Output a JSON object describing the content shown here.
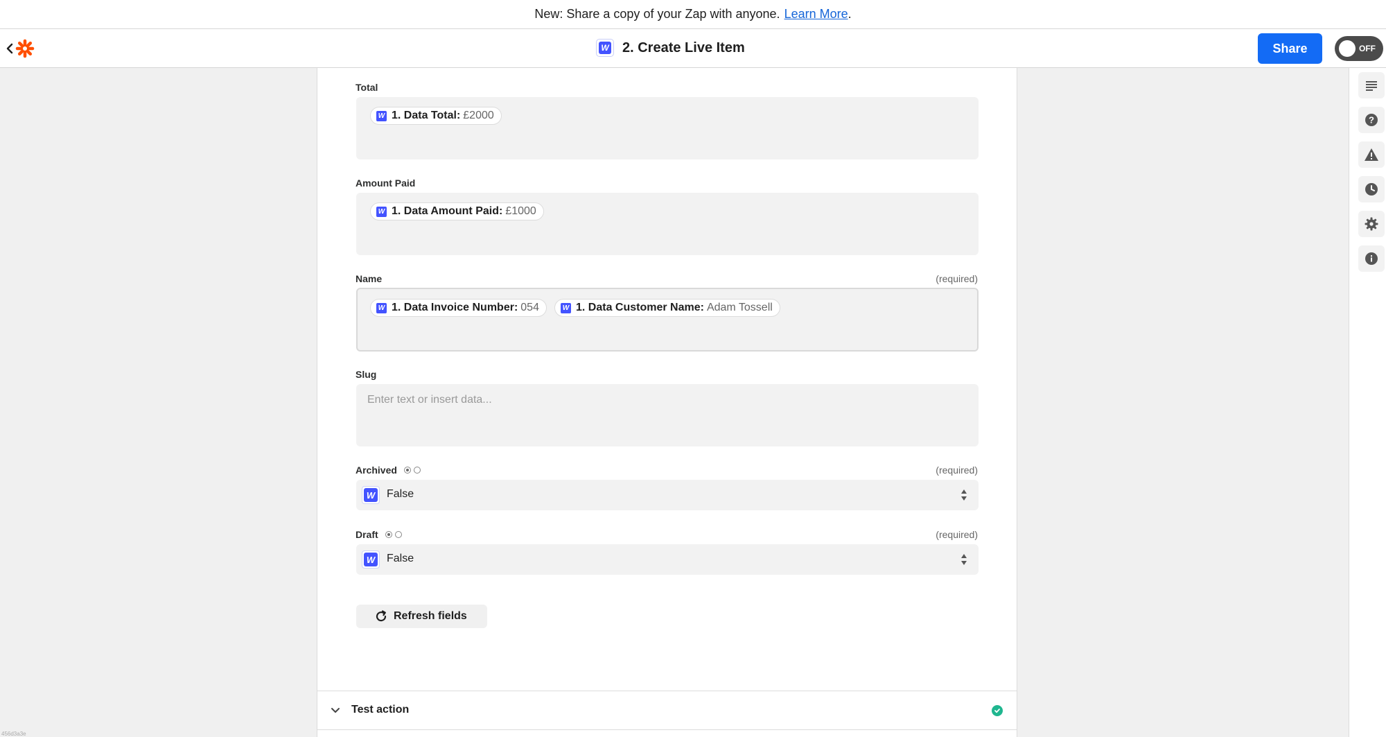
{
  "banner": {
    "text": "New: Share a copy of your Zap with anyone.",
    "link": "Learn More",
    "suffix": "."
  },
  "header": {
    "title": "2. Create Live Item",
    "app_badge": "W",
    "share_label": "Share",
    "toggle_label": "OFF"
  },
  "fields": {
    "total": {
      "label": "Total",
      "pills": [
        {
          "app": "W",
          "key": "1. Data Total:",
          "value": "£2000"
        }
      ]
    },
    "amount_paid": {
      "label": "Amount Paid",
      "pills": [
        {
          "app": "W",
          "key": "1. Data Amount Paid:",
          "value": "£1000"
        }
      ]
    },
    "name": {
      "label": "Name",
      "required": "(required)",
      "pills": [
        {
          "app": "W",
          "key": "1. Data Invoice Number:",
          "value": "054"
        },
        {
          "app": "W",
          "key": "1. Data Customer Name:",
          "value": "Adam Tossell"
        }
      ]
    },
    "slug": {
      "label": "Slug",
      "placeholder": "Enter text or insert data..."
    },
    "archived": {
      "label": "Archived",
      "required": "(required)",
      "value": "False",
      "app": "W"
    },
    "draft": {
      "label": "Draft",
      "required": "(required)",
      "value": "False",
      "app": "W"
    }
  },
  "refresh_label": "Refresh fields",
  "test_action": {
    "label": "Test action",
    "status": "complete"
  },
  "rail": {
    "icons": [
      "outline-icon",
      "help-icon",
      "warning-icon",
      "history-icon",
      "settings-icon",
      "info-icon"
    ]
  },
  "colors": {
    "accent": "#136bf5",
    "webflow": "#4353ff",
    "success": "#1fb68f",
    "zapier": "#ff4f00"
  },
  "corner_id": "456d3a3e"
}
